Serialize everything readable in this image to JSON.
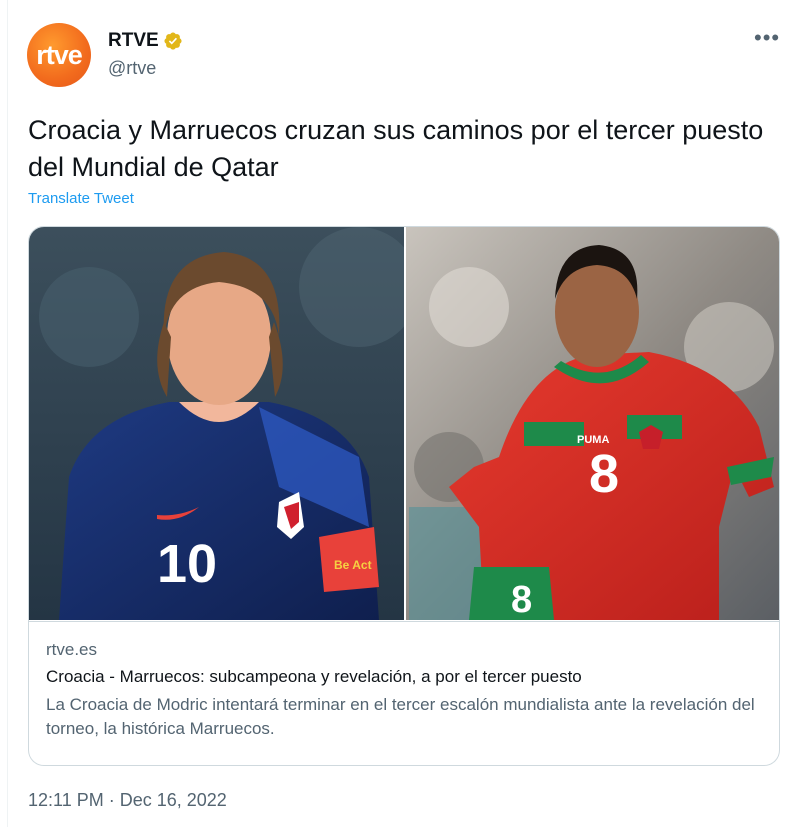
{
  "account": {
    "avatar_text": "rtve",
    "display_name": "RTVE",
    "handle": "@rtve",
    "verified": true,
    "brand_color": "#f26b1d"
  },
  "more_icon": "more-horizontal-icon",
  "tweet": {
    "text": "Croacia y Marruecos cruzan sus caminos por el tercer puesto del Mundial de Qatar",
    "translate_label": "Translate Tweet",
    "timestamp": "12:11 PM · Dec 16, 2022"
  },
  "card": {
    "domain": "rtve.es",
    "title": "Croacia - Marruecos: subcampeona y revelación, a por el tercer puesto",
    "description": "La Croacia de Modric intentará terminar en el tercer escalón mundialista ante la revelación del torneo, la histórica Marruecos.",
    "image": {
      "left_number": "10",
      "right_number": "8",
      "shorts_number": "8",
      "armband_text": "Be Act",
      "kit_brand": "PUMA"
    }
  },
  "colors": {
    "link": "#1d9bf0",
    "secondary_text": "#536471",
    "border": "#cfd9de"
  }
}
